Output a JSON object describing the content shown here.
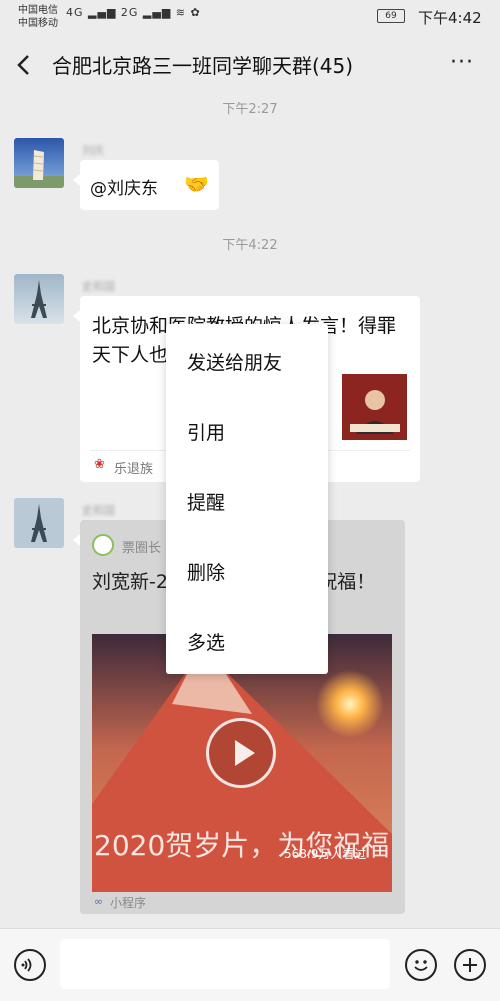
{
  "status_bar": {
    "carrier1": "中国电信",
    "carrier2": "中国移动",
    "battery": "69",
    "time": "下午4:42"
  },
  "header": {
    "title": "合肥北京路三一班同学聊天群(45)",
    "more": "···"
  },
  "messages": [
    {
      "timestamp": "下午2:27",
      "sender": "刘庆",
      "text": "@刘庆东"
    },
    {
      "timestamp": "下午4:22",
      "sender": "史和国",
      "article_title": "北京协和医院教授的惊人发言！得罪天下人也要说给你听！",
      "source": "乐退族"
    },
    {
      "sender": "史和国",
      "mini_source": "票圈长",
      "mini_title": "刘宽新-2020贺岁片，为您祝福！",
      "video_caption": "2020贺岁片，为您祝福",
      "views": "568.9万人看过",
      "footer": "小程序"
    }
  ],
  "context_menu": [
    "发送给朋友",
    "引用",
    "提醒",
    "删除",
    "多选"
  ],
  "colors": {
    "bg": "#ececec",
    "bubble": "#ffffff",
    "link_red": "#d9332e"
  }
}
